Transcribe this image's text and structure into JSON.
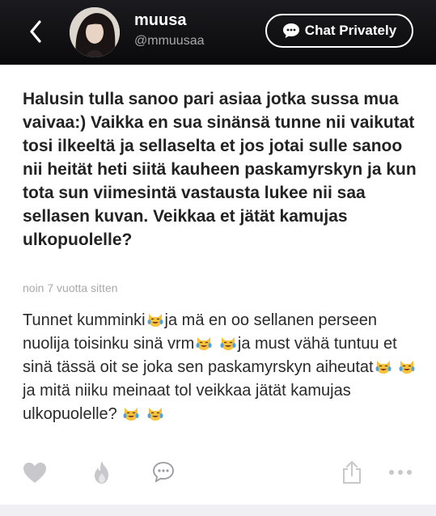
{
  "header": {
    "username": "muusa",
    "handle": "@mmuusaa",
    "chat_label": "Chat Privately"
  },
  "post": {
    "question": "Halusin tulla sanoo pari asiaa jotka sussa mua vaivaa:) Vaikka en sua sinänsä tunne nii vaikutat tosi ilkeeltä ja sellaselta et jos jotai sulle sanoo nii heität heti siitä kauheen paskamyrskyn ja kun tota sun viimesintä vastausta lukee nii saa sellasen kuvan. Veikkaa et jätät kamujas ulkopuolelle?",
    "timestamp": "noin 7 vuotta sitten",
    "answer_parts": [
      "Tunnet kumminki",
      "ja mä en oo sellanen perseen nuolija toisinku sinä vrm",
      "ja must vähä tuntuu et sinä tässä oit se joka sen paskamyrskyn aiheutat",
      "ja mitä niiku meinaat tol veikkaa jätät kamujas ulkopuolelle?"
    ]
  },
  "icons": {
    "back": "chevron-left-icon",
    "chat": "speech-bubble-icon",
    "emoji": "crying-laughing-cat-emoji",
    "like": "heart-icon",
    "fire": "flame-icon",
    "comment": "comment-icon",
    "share": "share-icon",
    "more": "more-icon"
  },
  "colors": {
    "header_bg": "#0f0f12",
    "icon_gray": "#c7c7cc",
    "emoji_yellow": "#f7c23a",
    "emoji_tear": "#4aa3e8"
  }
}
